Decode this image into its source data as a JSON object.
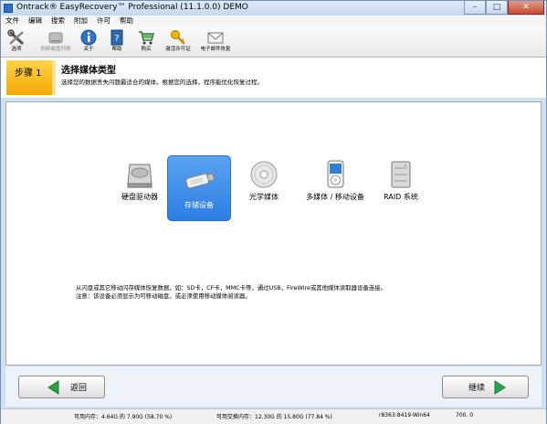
{
  "window": {
    "title": "Ontrack® EasyRecovery™ Professional (11.1.0.0) DEMO",
    "controls": {
      "minimize": "–",
      "maximize": "□",
      "close": "✕"
    }
  },
  "menu": [
    "文件",
    "编辑",
    "搜索",
    "附加",
    "许可",
    "帮助"
  ],
  "toolbar": [
    {
      "label": "选项",
      "icon": "tools-icon",
      "enabled": true
    },
    {
      "label": "刷新磁盘列表",
      "icon": "disk-refresh-icon",
      "enabled": false
    },
    {
      "label": "关于",
      "icon": "info-icon",
      "enabled": true
    },
    {
      "label": "帮助",
      "icon": "help-book-icon",
      "enabled": true
    },
    {
      "label": "购买",
      "icon": "cart-icon",
      "enabled": true
    },
    {
      "label": "激活许可证",
      "icon": "key-icon",
      "enabled": true
    },
    {
      "label": "电子邮件恢复",
      "icon": "mail-icon",
      "enabled": true
    }
  ],
  "step": {
    "label": "步骤 1",
    "title": "选择媒体类型",
    "description": "选择您的数据丢失问题最适合的媒体。根据您的选择，程序能优化恢复过程。"
  },
  "media_types": [
    {
      "label": "硬盘驱动器",
      "icon": "hard-drive-icon",
      "selected": false
    },
    {
      "label": "存储设备",
      "icon": "usb-drive-icon",
      "selected": true
    },
    {
      "label": "光学媒体",
      "icon": "optical-disc-icon",
      "selected": false
    },
    {
      "label": "多媒体 / 移动设备",
      "icon": "media-player-icon",
      "selected": false
    },
    {
      "label": "RAID 系统",
      "icon": "raid-icon",
      "selected": false
    }
  ],
  "info": {
    "line1": "从闪盘或其它移动闪存媒体恢复数据，如：SD卡，CF卡，MMC卡等，通过USB，FireWire或其他媒体读取器设备连接。",
    "line2": "注意：该设备必须显示为可移动磁盘，或必须使用移动媒体阅读器。"
  },
  "nav": {
    "back": "返回",
    "next": "继续"
  },
  "status": {
    "memory": "可用内存：4.64G 的 7.90G (58.70 %)",
    "swap": "可用交换内存：12.30G 的 15.80G (77.84 %)",
    "build": "r8363:8419-Win64",
    "version": "700. 0"
  },
  "colors": {
    "accent": "#2c7ee2",
    "step": "#f5a800",
    "nav_arrow": "#2aa24a"
  }
}
